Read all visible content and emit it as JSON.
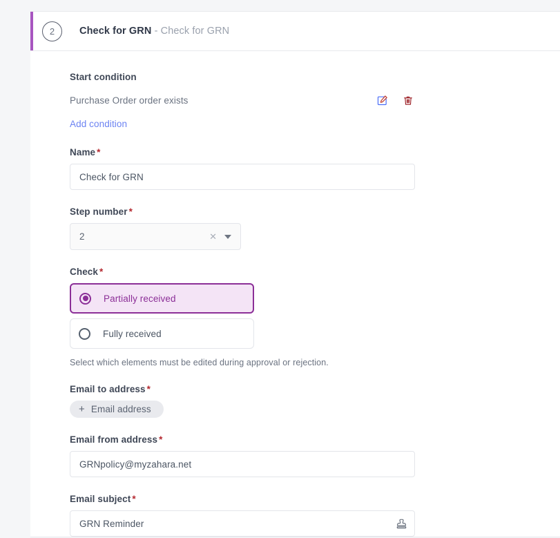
{
  "card": {
    "step_number_badge": "2",
    "title_bold": "Check for GRN",
    "title_separator": " - ",
    "title_sub": "Check for GRN",
    "accent_color": "#a855c0"
  },
  "start_condition": {
    "label": "Start condition",
    "condition_text": "Purchase Order order exists",
    "edit_icon": "edit-pencil-square-icon",
    "delete_icon": "trash-can-icon",
    "add_link": "Add condition",
    "link_color": "#6b82f2"
  },
  "fields": {
    "name": {
      "label": "Name",
      "required_marker": "*",
      "value": "Check for GRN",
      "placeholder": ""
    },
    "step_number": {
      "label": "Step number",
      "required_marker": "*",
      "value": "2",
      "clear_icon": "close-x-icon",
      "dropdown_icon": "chevron-down-icon"
    },
    "check": {
      "label": "Check",
      "required_marker": "*",
      "options": [
        {
          "label": "Partially received",
          "selected": true
        },
        {
          "label": "Fully received",
          "selected": false
        }
      ],
      "helper_text": "Select which elements must be edited during approval or rejection.",
      "selected_color": "#8b2e97",
      "selected_bg": "#f4e4f6"
    },
    "email_to_address": {
      "label": "Email to address",
      "required_marker": "*",
      "chip_plus": "+",
      "chip_label": "Email address"
    },
    "email_from_address": {
      "label": "Email from address",
      "required_marker": "*",
      "value": "GRNpolicy@myzahara.net",
      "placeholder": ""
    },
    "email_subject": {
      "label": "Email subject",
      "required_marker": "*",
      "value": "GRN Reminder",
      "placeholder": "",
      "stamp_icon": "rubber-stamp-icon"
    }
  }
}
